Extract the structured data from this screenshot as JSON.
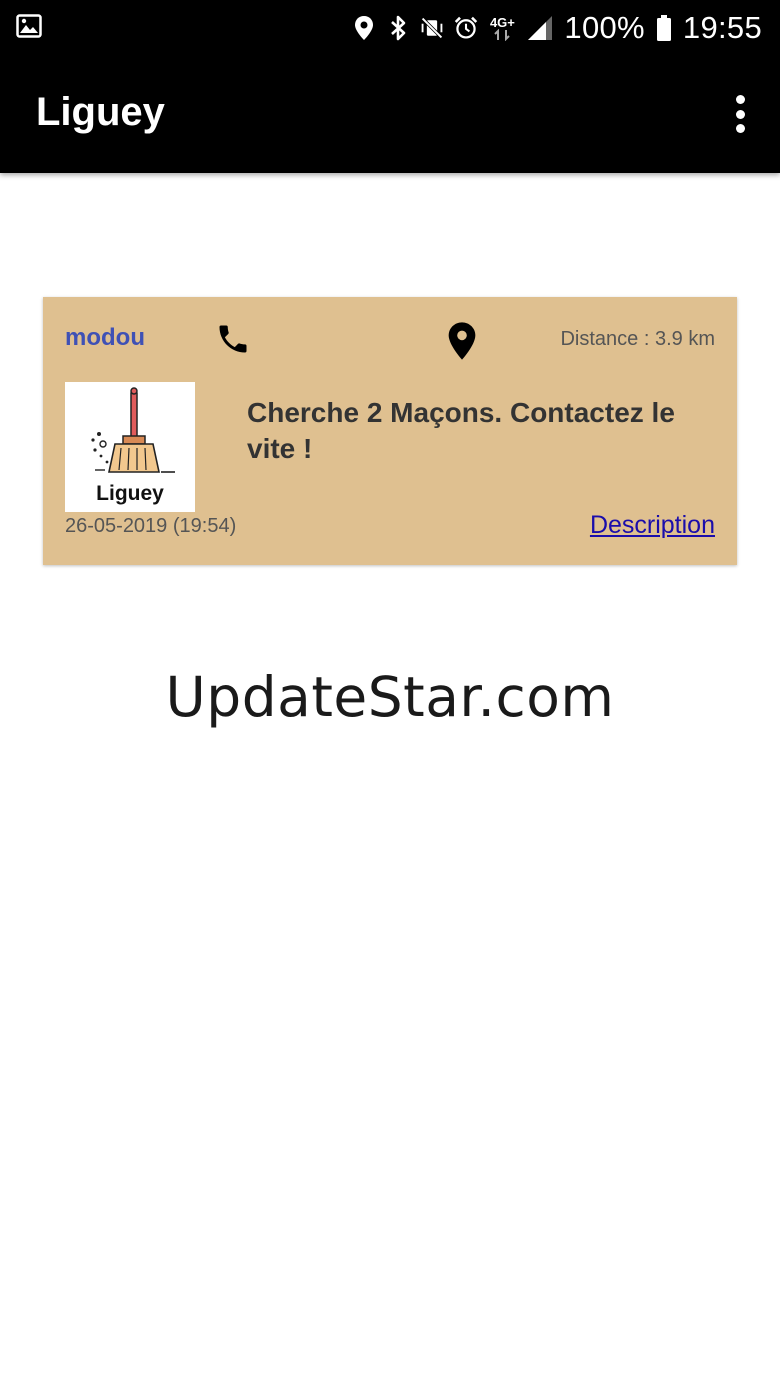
{
  "status_bar": {
    "left_icon": "image-icon",
    "icons": [
      "location-icon",
      "bluetooth-icon",
      "vibrate-off-icon",
      "alarm-icon",
      "network-4g-icon",
      "signal-icon"
    ],
    "network_label": "4G+",
    "battery_percent": "100%",
    "battery_icon": "battery-full-icon",
    "time": "19:55"
  },
  "app_bar": {
    "title": "Liguey",
    "menu_icon": "more-vert-icon"
  },
  "listing": {
    "username": "modou",
    "phone_icon": "phone-icon",
    "location_icon": "map-pin-icon",
    "distance": "Distance : 3.9 km",
    "logo_text": "Liguey",
    "message": "Cherche 2 Maçons. Contactez le vite !",
    "date": "26-05-2019 (19:54)",
    "description_link": "Description",
    "card_color": "#dfc090",
    "username_color": "#3f51b5",
    "link_color": "#1a0dab"
  },
  "watermark": "UpdateStar.com"
}
